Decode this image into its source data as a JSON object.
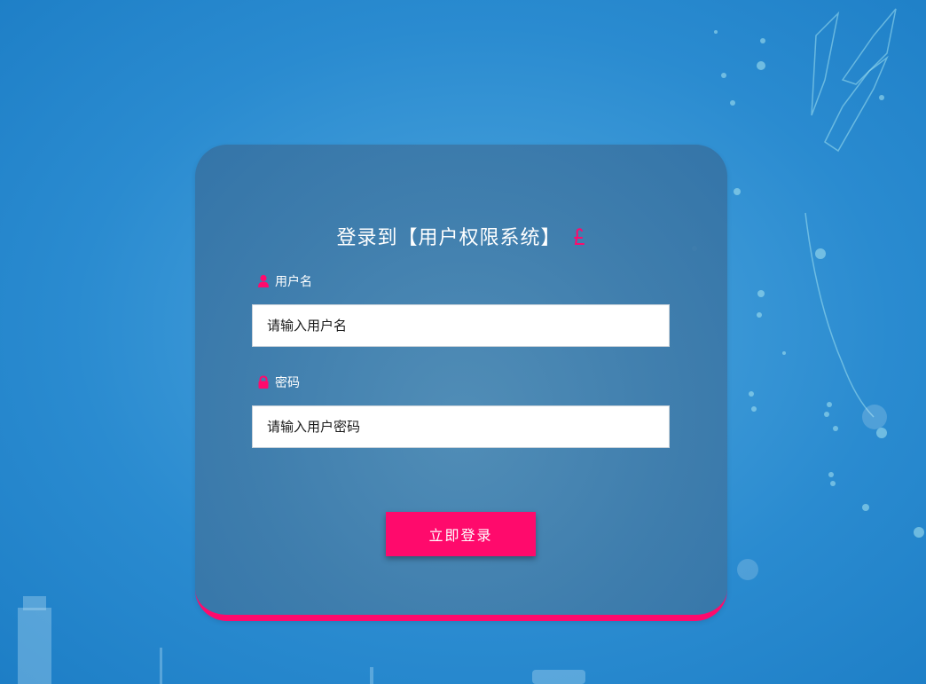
{
  "login": {
    "title": "登录到【用户权限系统】",
    "username_label": "用户名",
    "username_placeholder": "请输入用户名",
    "password_label": "密码",
    "password_placeholder": "请输入用户密码",
    "submit_label": "立即登录"
  },
  "icons": {
    "title_icon": "pound-sign-icon",
    "username_icon": "user-icon",
    "password_icon": "lock-icon"
  },
  "colors": {
    "accent": "#ff0a6c",
    "background": "#2a8bd0",
    "card": "#4580b0"
  }
}
